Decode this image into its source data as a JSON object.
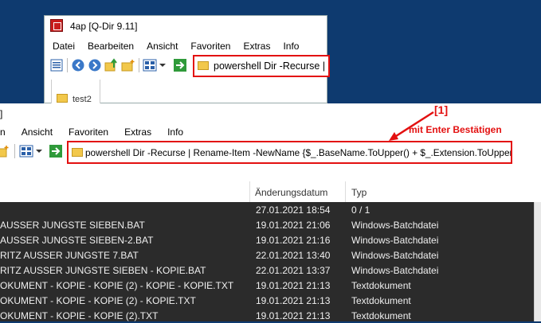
{
  "top_window": {
    "title": "4ap  [Q-Dir 9.11]",
    "menu": [
      "Datei",
      "Bearbeiten",
      "Ansicht",
      "Favoriten",
      "Extras",
      "Info"
    ],
    "address": "powershell Dir -Recurse | Re",
    "tab_label": "test2"
  },
  "main_window": {
    "title_fragment": "]",
    "menu": [
      "n",
      "Ansicht",
      "Favoriten",
      "Extras",
      "Info"
    ],
    "address": "powershell Dir -Recurse | Rename-Item -NewName {$_.BaseName.ToUpper() + $_.Extension.ToUpper()}"
  },
  "annotations": {
    "step": "[1]",
    "hint": "mit Enter Bestätigen"
  },
  "columns": {
    "date": "Änderungsdatum",
    "type": "Typ"
  },
  "rows": [
    {
      "name": "",
      "date": "27.01.2021 18:54",
      "type": "0 / 1"
    },
    {
      "name": "AUSSER JUNGSTE SIEBEN.BAT",
      "date": "19.01.2021 21:06",
      "type": "Windows-Batchdatei"
    },
    {
      "name": "AUSSER JUNGSTE SIEBEN-2.BAT",
      "date": "19.01.2021 21:16",
      "type": "Windows-Batchdatei"
    },
    {
      "name": "RITZ AUSSER JUNGSTE 7.BAT",
      "date": "22.01.2021 13:40",
      "type": "Windows-Batchdatei"
    },
    {
      "name": "RITZ AUSSER JUNGSTE SIEBEN - KOPIE.BAT",
      "date": "22.01.2021 13:37",
      "type": "Windows-Batchdatei"
    },
    {
      "name": "OKUMENT - KOPIE - KOPIE (2) - KOPIE - KOPIE.TXT",
      "date": "19.01.2021 21:13",
      "type": "Textdokument"
    },
    {
      "name": "OKUMENT - KOPIE - KOPIE (2) - KOPIE.TXT",
      "date": "19.01.2021 21:13",
      "type": "Textdokument"
    },
    {
      "name": "OKUMENT - KOPIE - KOPIE (2).TXT",
      "date": "19.01.2021 21:13",
      "type": "Textdokument"
    }
  ],
  "colors": {
    "background": "#0e3a6f",
    "highlight": "#e31010",
    "rows_bg": "#2b2b2b"
  }
}
